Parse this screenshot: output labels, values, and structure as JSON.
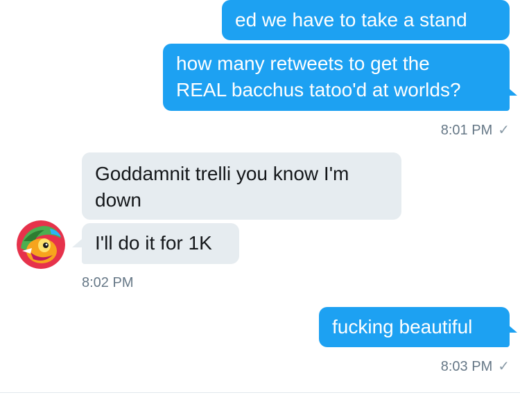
{
  "messages": [
    {
      "text": "ed we have to take a stand",
      "direction": "outgoing"
    },
    {
      "line1": "how many retweets to get the",
      "line2": "REAL bacchus tatoo'd at worlds?",
      "direction": "outgoing"
    },
    {
      "line1": "Goddamnit trelli you know I'm",
      "line2": "down",
      "direction": "incoming"
    },
    {
      "text": "I'll do it for 1K",
      "direction": "incoming"
    },
    {
      "text": "fucking beautiful",
      "direction": "outgoing"
    }
  ],
  "timestamps": {
    "first": "8:01 PM",
    "second": "8:02 PM",
    "third": "8:03 PM"
  },
  "icons": {
    "read_receipt": "checkmark-icon",
    "avatar": "cartoon-character-avatar"
  },
  "colors": {
    "outgoing_bubble": "#1da1f2",
    "incoming_bubble": "#e6ecf0",
    "timestamp": "#657786"
  }
}
